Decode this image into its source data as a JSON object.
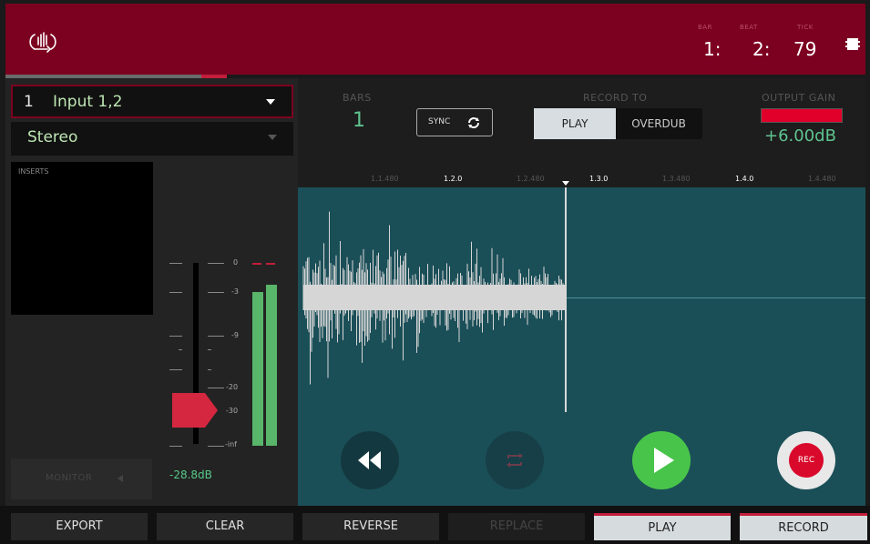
{
  "header": {
    "counter": [
      {
        "label": "BAR",
        "value": "1:"
      },
      {
        "label": "BEAT",
        "value": "2:"
      },
      {
        "label": "TICK",
        "value": "79"
      }
    ]
  },
  "input": {
    "number": "1",
    "name": "Input 1,2",
    "mode": "Stereo"
  },
  "inserts_label": "INSERTS",
  "monitor_label": "MONITOR",
  "meter": {
    "scale": [
      "0",
      "-3",
      "-9",
      "-20",
      "-30",
      "-inf"
    ],
    "gain_readout": "-28.8dB",
    "level_left": 0.84,
    "level_right": 0.88
  },
  "bars": {
    "label": "BARS",
    "value": "1"
  },
  "sync_label": "SYNC",
  "record_to": {
    "label": "RECORD TO",
    "options": [
      "PLAY",
      "OVERDUB"
    ],
    "selected": "PLAY"
  },
  "output_gain": {
    "label": "OUTPUT GAIN",
    "value": "+6.00dB"
  },
  "ruler": [
    {
      "text": "1.1.480",
      "major": false
    },
    {
      "text": "1.2.0",
      "major": true
    },
    {
      "text": "1.2.480",
      "major": false
    },
    {
      "text": "1.3.0",
      "major": true
    },
    {
      "text": "1.3.480",
      "major": false
    },
    {
      "text": "1.4.0",
      "major": true
    },
    {
      "text": "1.4.480",
      "major": false
    }
  ],
  "transport": {
    "rec_label": "REC"
  },
  "bottom_buttons": [
    "EXPORT",
    "CLEAR",
    "REVERSE",
    "REPLACE",
    "PLAY",
    "RECORD"
  ],
  "colors": {
    "header": "#7c0020",
    "accent_red": "#c21d3b",
    "meter_green": "#58b56a",
    "wave_bg": "#1b4f58"
  }
}
